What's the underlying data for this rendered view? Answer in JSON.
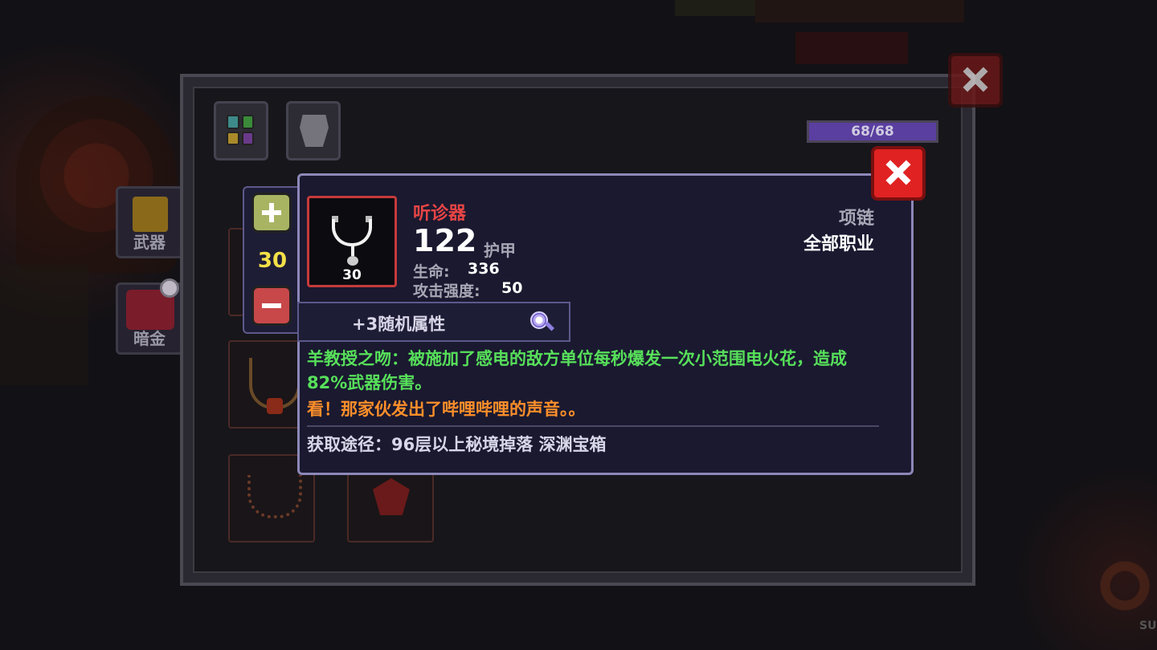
{
  "panel": {
    "hp_text": "68/68",
    "hp_fraction": 1.0,
    "tabs": [
      {
        "name": "all-items",
        "icon": "grid-icon"
      },
      {
        "name": "armor",
        "icon": "helmet-icon"
      }
    ],
    "side_tabs": [
      {
        "label": "武器",
        "icon": "weapon-icon"
      },
      {
        "label": "暗金",
        "icon": "dark-gold-icon"
      }
    ]
  },
  "stepper": {
    "value": "30"
  },
  "item": {
    "name": "听诊器",
    "level": "30",
    "armor_value": "122",
    "armor_label": "护甲",
    "slot_type": "项链",
    "class_requirement": "全部职业",
    "stats": [
      {
        "label": "生命:",
        "value": "336"
      },
      {
        "label": "攻击强度:",
        "value": "50"
      }
    ],
    "random_attributes": "+3随机属性",
    "effect_description": "羊教授之吻：被施加了感电的敌方单位每秒爆发一次小范围电火花，造成82%武器伤害。",
    "flavor_text": "看！那家伙发出了哔哩哔哩的声音。。",
    "source": "获取途径：96层以上秘境掉落 深渊宝箱",
    "colors": {
      "name": "#e84545",
      "effect": "#57e05a",
      "flavor": "#ff8f2a",
      "frame": "#c63a3a"
    }
  },
  "background": {
    "corner_text": "SU"
  }
}
